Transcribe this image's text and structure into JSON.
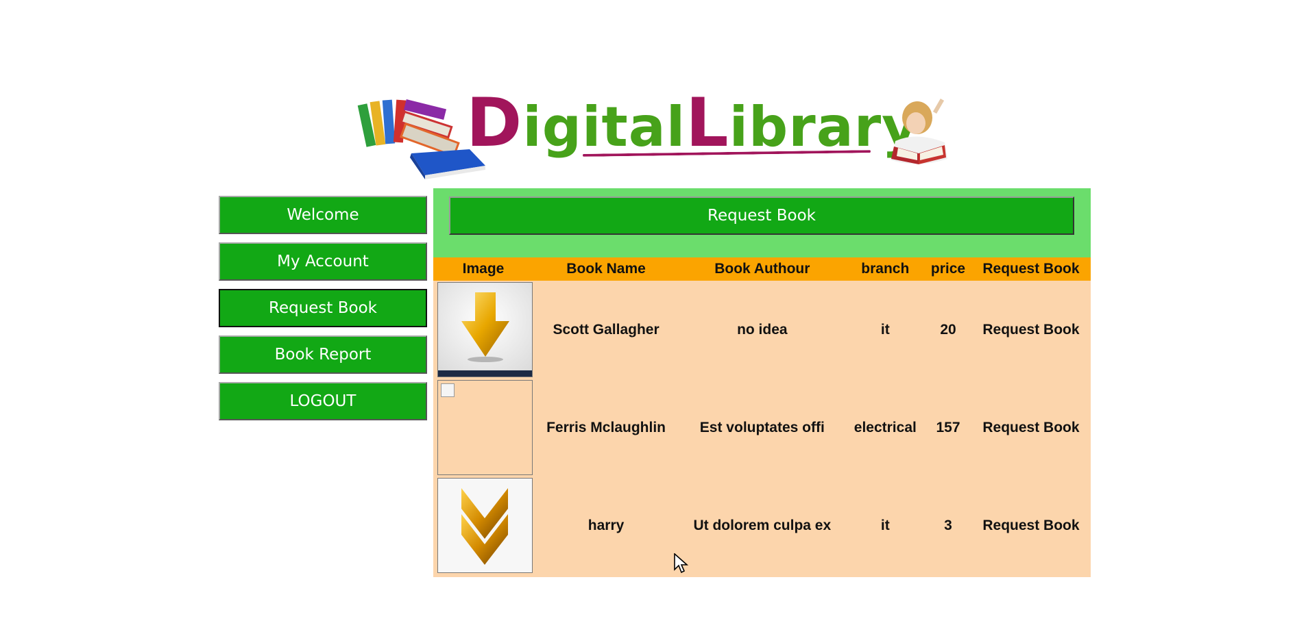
{
  "logo": {
    "cap_d": "D",
    "rest_1": "igital",
    "cap_l": "L",
    "rest_2": "ibrary"
  },
  "sidebar": {
    "items": [
      {
        "label": "Welcome"
      },
      {
        "label": "My Account"
      },
      {
        "label": "Request Book",
        "active": true
      },
      {
        "label": "Book Report"
      },
      {
        "label": "LOGOUT"
      }
    ]
  },
  "main": {
    "title": "Request Book",
    "table": {
      "headers": [
        "Image",
        "Book Name",
        "Book Authour",
        "branch",
        "price",
        "Request Book"
      ],
      "rows": [
        {
          "image": "down-arrow-icon",
          "name": "Scott Gallagher",
          "author": "no idea",
          "branch": "it",
          "price": "20",
          "action": "Request Book"
        },
        {
          "image": "broken-image",
          "name": "Ferris Mclaughlin",
          "author": "Est voluptates offi",
          "branch": "electrical",
          "price": "157",
          "action": "Request Book"
        },
        {
          "image": "chevron-down-icon",
          "name": "harry",
          "author": "Ut dolorem culpa ex",
          "branch": "it",
          "price": "3",
          "action": "Request Book"
        }
      ]
    }
  },
  "colors": {
    "button_green": "#12a815",
    "header_green": "#6bdd6c",
    "table_header_orange": "#fba400",
    "table_body_peach": "#fcd5ac",
    "logo_magenta": "#a1155b",
    "logo_green": "#47a21a"
  }
}
